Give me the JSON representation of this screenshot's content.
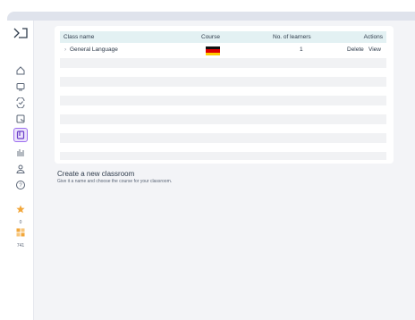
{
  "table": {
    "headers": {
      "class_name": "Class name",
      "course": "Course",
      "learners": "No. of learners",
      "actions": "Actions"
    },
    "rows": [
      {
        "class_name": "General Language",
        "expand_glyph": "›",
        "course_flag": "german-flag-icon",
        "learners": "1",
        "delete": "Delete",
        "view": "View"
      }
    ],
    "empty_rows": 8
  },
  "create": {
    "title": "Create a new classroom",
    "subtitle": "Give it a name and choose the course for your classroom."
  },
  "sidebar": {
    "stats": [
      {
        "icon": "star-icon",
        "value": "0",
        "color": "#f2a73b"
      },
      {
        "icon": "xp-icon",
        "value": "741",
        "color": "#f2a73b"
      }
    ],
    "active_item": "classroom-icon"
  },
  "colors": {
    "accent": "#9d6ff0",
    "header_bg": "#e3f1f3",
    "stripe": "#f1f2f4",
    "star": "#f2a73b"
  }
}
